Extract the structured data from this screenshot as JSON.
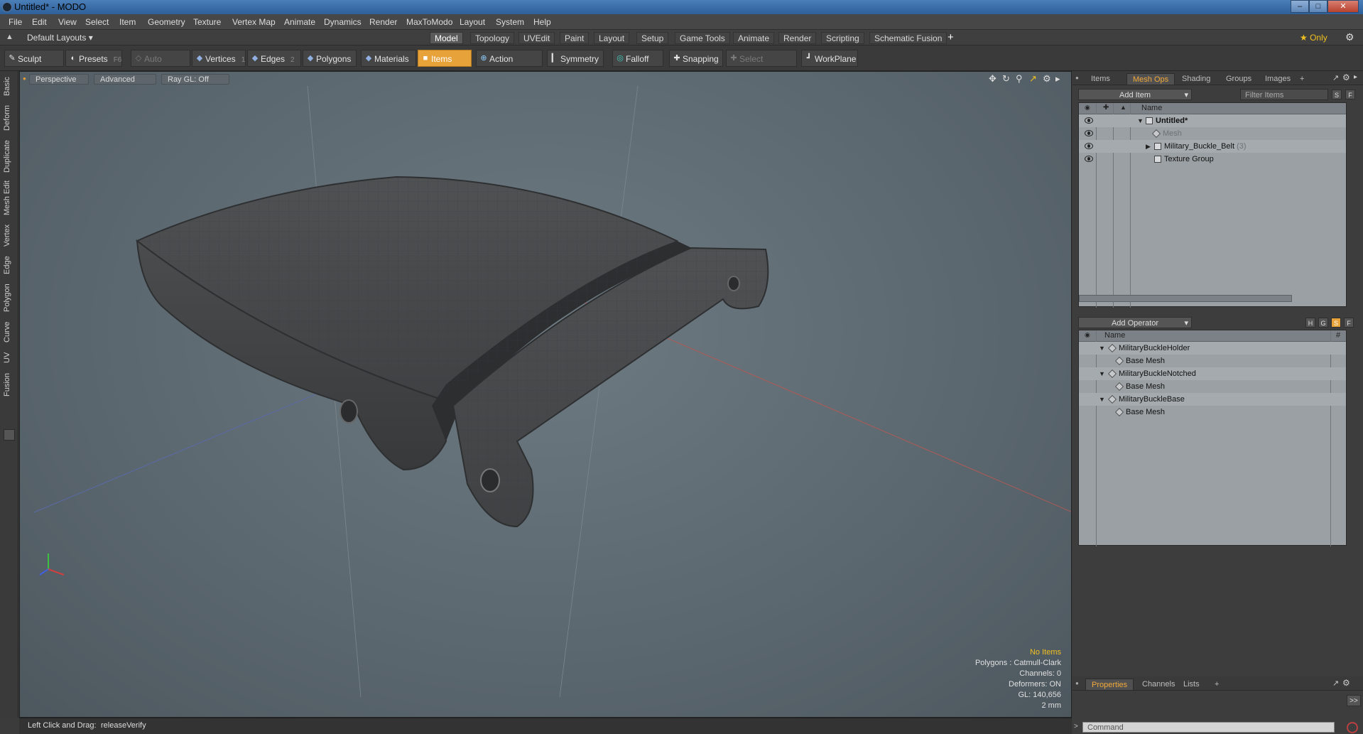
{
  "window": {
    "title": "Untitled* - MODO",
    "minimize": "–",
    "maximize": "□",
    "close": "✕"
  },
  "menu": [
    "File",
    "Edit",
    "View",
    "Select",
    "Item",
    "Geometry",
    "Texture",
    "Vertex Map",
    "Animate",
    "Dynamics",
    "Render",
    "MaxToModo",
    "Layout",
    "System",
    "Help"
  ],
  "layoutbar": {
    "layout_name": "Default Layouts ▾",
    "tabs": [
      "Model",
      "Topology",
      "UVEdit",
      "Paint",
      "Layout",
      "Setup",
      "Game Tools",
      "Animate",
      "Render",
      "Scripting",
      "Schematic Fusion"
    ],
    "active_tab": "Model",
    "add": "+",
    "only": "★ Only",
    "gear": "⚙"
  },
  "toolbar": {
    "sculpt": "Sculpt",
    "presets": "Presets",
    "presets_key": "F6",
    "auto_select": "Auto Select",
    "vertices": "Vertices",
    "vertices_key": "1",
    "edges": "Edges",
    "edges_key": "2",
    "polygons": "Polygons",
    "materials": "Materials",
    "items": "Items",
    "action_center": "Action Center",
    "symmetry": "Symmetry",
    "falloff": "Falloff",
    "snapping": "Snapping",
    "select_through": "Select Through",
    "workplane": "WorkPlane"
  },
  "lefttabs": [
    "Basic",
    "Deform",
    "Duplicate",
    "Mesh Edit",
    "Vertex",
    "Edge",
    "Polygon",
    "Curve",
    "UV",
    "Fusion"
  ],
  "viewport": {
    "view": "Perspective",
    "shading": "Advanced",
    "raygl": "Ray GL: Off"
  },
  "stats": {
    "selection": "No Items",
    "polygons": "Polygons : Catmull-Clark",
    "channels": "Channels: 0",
    "deformers": "Deformers: ON",
    "gl": "GL: 140,656",
    "unit": "2 mm"
  },
  "status": {
    "hint_label": "Left Click and Drag:",
    "hint_value": "releaseVerify"
  },
  "items_panel": {
    "tabs": [
      "Items",
      "Mesh Ops",
      "Shading",
      "Groups",
      "Images"
    ],
    "active_tab": "Mesh Ops",
    "add_tab": "+",
    "add_item": "Add Item",
    "filter": "Filter Items",
    "s_btn": "S",
    "f_btn": "F",
    "col_name": "Name",
    "rows": [
      {
        "label": "Untitled*"
      },
      {
        "label": "Mesh"
      },
      {
        "label": "Military_Buckle_Belt",
        "count": "(3)"
      },
      {
        "label": "Texture Group"
      }
    ]
  },
  "meshops_panel": {
    "add_operator": "Add Operator",
    "h_btn": "H",
    "g_btn": "G",
    "s_btn": "S",
    "f_btn": "F",
    "col_name": "Name",
    "col_hash": "#",
    "rows": [
      {
        "label": "MilitaryBuckleHolder"
      },
      {
        "label": "Base Mesh"
      },
      {
        "label": "MilitaryBuckleNotched"
      },
      {
        "label": "Base Mesh"
      },
      {
        "label": "MilitaryBuckleBase"
      },
      {
        "label": "Base Mesh"
      }
    ]
  },
  "properties_panel": {
    "tabs": [
      "Properties",
      "Channels",
      "Lists"
    ],
    "active_tab": "Properties",
    "add_tab": "+",
    "expand": ">>"
  },
  "command": {
    "placeholder": "Command"
  }
}
